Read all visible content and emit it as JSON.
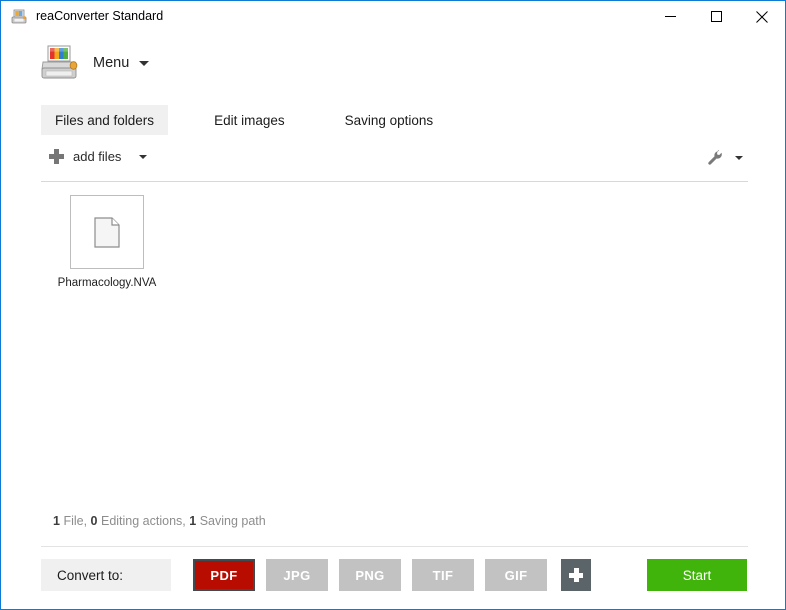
{
  "window": {
    "title": "reaConverter Standard",
    "icon": "printer-scanner-icon",
    "accent_border": "#0d7bd4",
    "controls": {
      "minimize": "minimize",
      "maximize": "maximize",
      "close": "close"
    }
  },
  "menubar": {
    "logo_icon": "printer-scanner-logo",
    "menu_label": "Menu",
    "menu_caret": "chevron-down-icon"
  },
  "tabs": [
    {
      "label": "Files and folders",
      "active": true
    },
    {
      "label": "Edit images",
      "active": false
    },
    {
      "label": "Saving options",
      "active": false
    }
  ],
  "toolbar": {
    "add_files_label": "add files",
    "add_files_icon": "plus-icon",
    "add_files_caret": "chevron-down-icon",
    "settings_icon": "wrench-icon",
    "settings_caret": "chevron-down-icon"
  },
  "files": [
    {
      "name": "Pharmacology.NVA",
      "icon": "document-icon"
    }
  ],
  "status": {
    "file_count": "1",
    "file_label": "File,",
    "editing_count": "0",
    "editing_label": "Editing actions,",
    "saving_count": "1",
    "saving_label": "Saving path"
  },
  "bottom": {
    "convert_to_label": "Convert to:",
    "formats": [
      {
        "label": "PDF",
        "selected": true
      },
      {
        "label": "JPG",
        "selected": false
      },
      {
        "label": "PNG",
        "selected": false
      },
      {
        "label": "TIF",
        "selected": false
      },
      {
        "label": "GIF",
        "selected": false
      }
    ],
    "add_format_icon": "plus-icon",
    "start_label": "Start"
  },
  "colors": {
    "selected_format": "#b80c00",
    "unselected_format": "#c2c2c2",
    "start_green": "#41b40c",
    "add_format": "#5b6569",
    "window_accent": "#0d7bd4",
    "active_tab_bg": "#f0f0f0"
  }
}
